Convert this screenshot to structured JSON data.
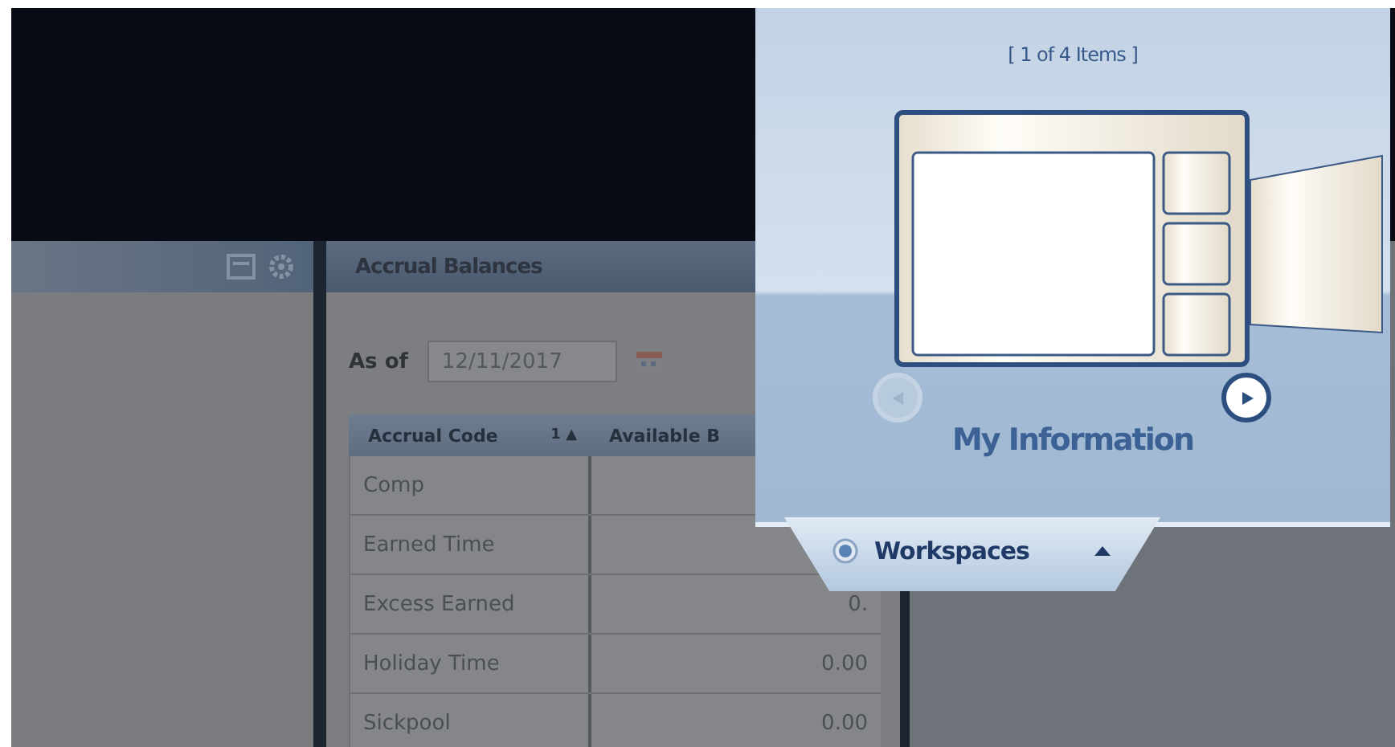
{
  "accrual_panel": {
    "title": "Accrual Balances",
    "as_of_label": "As of",
    "date": "12/11/2017",
    "table": {
      "columns": [
        {
          "label": "Accrual Code",
          "sort_order": "1",
          "sort_arrow": "▲"
        },
        {
          "label": "Available B"
        }
      ],
      "rows": [
        {
          "code": "Comp"
        },
        {
          "code": "Earned Time"
        },
        {
          "code": "Excess Earned",
          "value": "0."
        },
        {
          "code": "Holiday Time",
          "value": "0.00"
        },
        {
          "code": "Sickpool",
          "value": "0.00"
        }
      ]
    }
  },
  "workspace_popup": {
    "counter": "[ 1 of 4 Items ]",
    "item_title": "My Information",
    "prev_disabled": true,
    "next_disabled": false
  },
  "workspaces_tab": {
    "label": "Workspaces",
    "expanded": true
  }
}
